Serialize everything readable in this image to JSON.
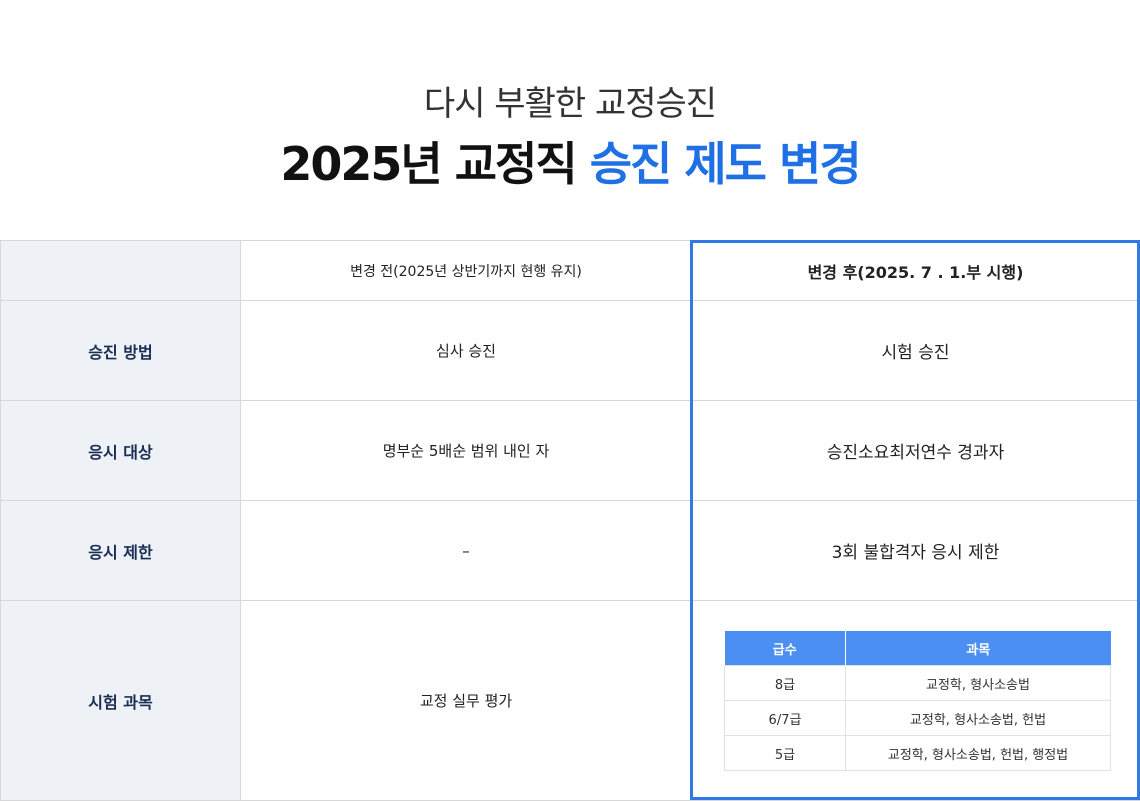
{
  "header": {
    "subtitle": "다시 부활한 교정승진",
    "title_main": "2025년 교정직 ",
    "title_highlight": "승진 제도 변경"
  },
  "colors": {
    "accent": "#1f6fe5",
    "frame": "#2e7be6",
    "table_head": "#4b8ff2",
    "label_bg": "#eef1f6",
    "label_text": "#1a2d52"
  },
  "comparison": {
    "head": {
      "label": "",
      "before": "변경 전(2025년 상반기까지 현행 유지)",
      "after": "변경 후(2025. 7 . 1.부 시행)"
    },
    "rows": [
      {
        "label": "승진 방법",
        "before": "심사 승진",
        "after": "시험 승진"
      },
      {
        "label": "응시 대상",
        "before": "명부순 5배순 범위 내인 자",
        "after": "승진소요최저연수 경과자"
      },
      {
        "label": "응시 제한",
        "before": "–",
        "after": "3회 불합격자 응시 제한"
      },
      {
        "label": "시험 과목",
        "before": "교정 실무 평가",
        "after": ""
      }
    ]
  },
  "subjects_table": {
    "headers": [
      "급수",
      "과목"
    ],
    "rows": [
      [
        "8급",
        "교정학, 형사소송법"
      ],
      [
        "6/7급",
        "교정학, 형사소송법, 헌법"
      ],
      [
        "5급",
        "교정학, 형사소송법, 헌법, 행정법"
      ]
    ]
  }
}
